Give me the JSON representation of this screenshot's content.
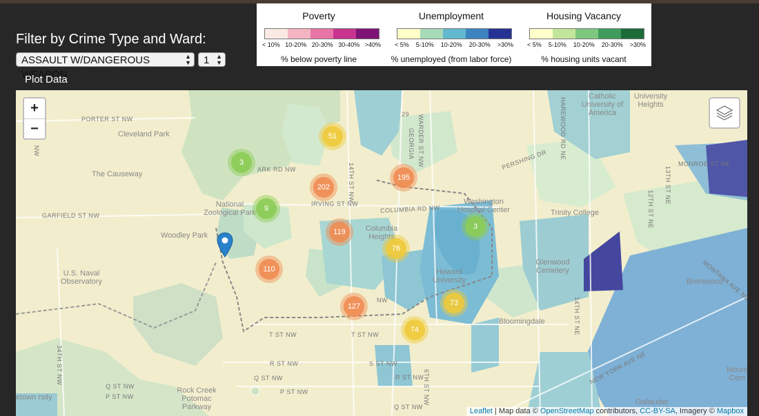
{
  "filter": {
    "title": "Filter by Crime Type and Ward:",
    "crime_type": "ASSAULT W/DANGEROUS WEAPON",
    "ward": "1",
    "plot_label": "Plot Data"
  },
  "legends": [
    {
      "title": "Poverty",
      "colors": [
        "#fbe9e3",
        "#f4b4c2",
        "#e875a6",
        "#c8348f",
        "#7e1477"
      ],
      "ticks": [
        "< 10%",
        "10-20%",
        "20-30%",
        "30-40%",
        ">40%"
      ],
      "caption": "% below poverty line"
    },
    {
      "title": "Unemployment",
      "colors": [
        "#ffffc7",
        "#a7dab7",
        "#62b8cf",
        "#3c83c0",
        "#263293"
      ],
      "ticks": [
        "< 5%",
        "5-10%",
        "10-20%",
        "20-30%",
        ">30%"
      ],
      "caption": "% unemployed (from labor force)"
    },
    {
      "title": "Housing Vacancy",
      "colors": [
        "#ffffcb",
        "#c3e59b",
        "#7ec77f",
        "#3f9c5a",
        "#1b6c39"
      ],
      "ticks": [
        "< 5%",
        "5-10%",
        "10-20%",
        "20-30%",
        ">30%"
      ],
      "caption": "% housing units vacant"
    }
  ],
  "map": {
    "zoom_in": "+",
    "zoom_out": "−",
    "clusters": [
      {
        "label": "51",
        "size": "medium"
      },
      {
        "label": "3",
        "size": "small"
      },
      {
        "label": "202",
        "size": "large"
      },
      {
        "label": "195",
        "size": "large"
      },
      {
        "label": "9",
        "size": "small"
      },
      {
        "label": "119",
        "size": "large"
      },
      {
        "label": "3",
        "size": "small"
      },
      {
        "label": "76",
        "size": "medium"
      },
      {
        "label": "110",
        "size": "large"
      },
      {
        "label": "127",
        "size": "large"
      },
      {
        "label": "73",
        "size": "medium"
      },
      {
        "label": "74",
        "size": "medium"
      }
    ],
    "cluster_colors": {
      "small": "#8ccc55",
      "medium": "#efca3b",
      "large": "#ef8c52"
    },
    "streets": [
      "PORTER ST NW",
      "GARFIELD ST NW",
      "IRVING ST NW",
      "COLUMBIA RD NW",
      "PERSHING DR",
      "MONROE ST NE",
      "T ST NW",
      "T ST NW",
      "R ST NW",
      "Q ST NW",
      "Q ST NW",
      "P ST NW",
      "P ST NW",
      "NEW YORK AVE NE",
      "MONTANA AVE NE",
      "13TH ST NE",
      "12TH ST NE",
      "14TH ST NE",
      "GEORGIA",
      "WARDER ST NW",
      "HAREWOOD RD NE",
      "ARK RD NW",
      "NW",
      "NW",
      "S ST NW",
      "R ST NW",
      "Q ST NW",
      "14TH ST NW",
      "6TH ST NW",
      "34TH ST NW",
      "29"
    ],
    "places": [
      "Cleveland Park",
      "The Causeway",
      "National Zoological Park",
      "Woodley Park",
      "U.S. Naval Observatory",
      "Washington Hospital Center",
      "Catholic University of America",
      "University Heights",
      "Trinity College",
      "Glenwood Cemetery",
      "Howard University",
      "Bloomingdale",
      "Brentwood",
      "Rock Creek Potomac Parkway",
      "Gallaudet",
      "Mount Cem",
      "etown rsity",
      "Columbia Heights"
    ],
    "attribution": {
      "leaflet": "Leaflet",
      "sep": " | Map data © ",
      "osm": "OpenStreetMap",
      "mid": " contributors, ",
      "license": "CC-BY-SA",
      "imagery": ", Imagery © ",
      "mapbox": "Mapbox"
    }
  }
}
